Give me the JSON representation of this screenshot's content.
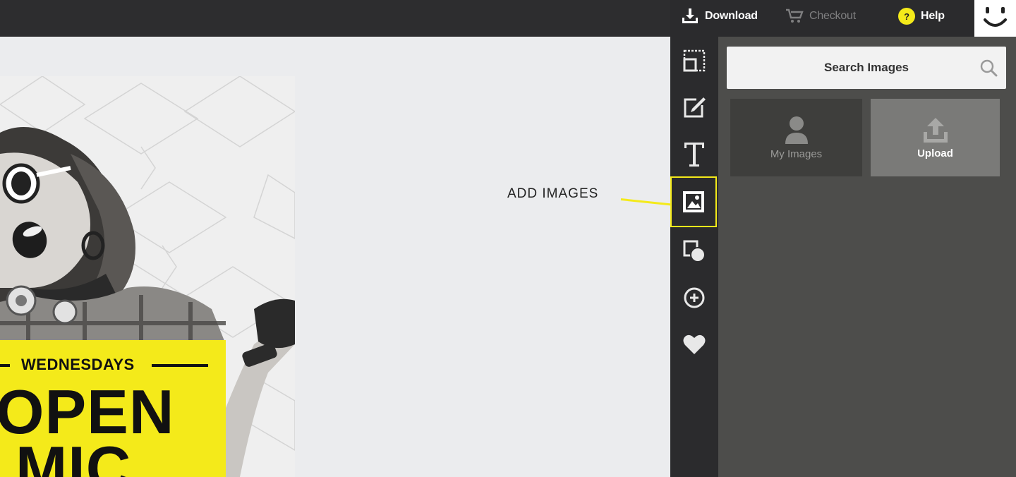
{
  "topbar": {
    "download_label": "Download",
    "checkout_label": "Checkout",
    "help_label": "Help",
    "help_glyph": "?"
  },
  "canvas": {
    "poster_day": "WEDNESDAYS",
    "poster_line1": "OPEN",
    "poster_line2": "MIC"
  },
  "callout": {
    "label": "ADD IMAGES"
  },
  "rail": {
    "items": [
      {
        "icon": "resize-icon",
        "active": false
      },
      {
        "icon": "edit-icon",
        "active": false
      },
      {
        "icon": "text-icon",
        "active": false
      },
      {
        "icon": "image-icon",
        "active": true
      },
      {
        "icon": "shapes-icon",
        "active": false
      },
      {
        "icon": "add-circle-icon",
        "active": false
      },
      {
        "icon": "heart-icon",
        "active": false
      }
    ]
  },
  "panel": {
    "search_label": "Search Images",
    "my_images_label": "My Images",
    "upload_label": "Upload"
  },
  "colors": {
    "accent": "#f4ea1a",
    "dark": "#2b2b2d",
    "panel": "#4d4d4b"
  }
}
